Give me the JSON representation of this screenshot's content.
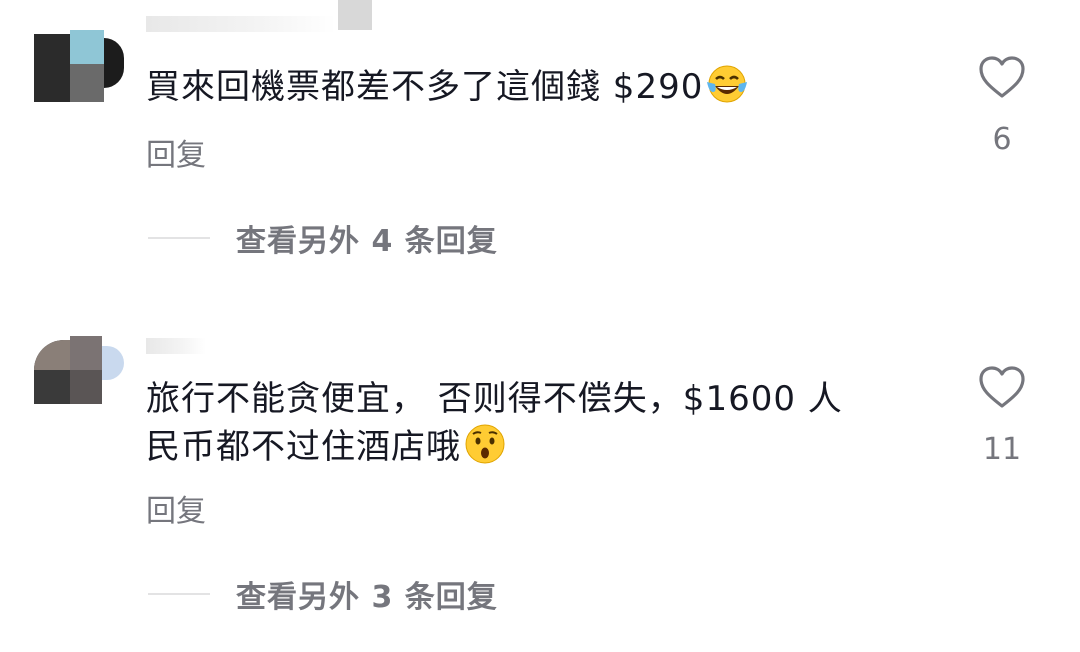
{
  "comments": [
    {
      "text": "買來回機票都差不多了這個錢 $290",
      "emoji": "tears-of-joy-emoji",
      "reply_label": "回复",
      "likes": "6",
      "view_replies": "查看另外 4 条回复"
    },
    {
      "text_line1": "旅行不能贪便宜， 否则得不偿失，$1600 人",
      "text_line2": "民币都不过住酒店哦",
      "emoji": "astonished-face-emoji",
      "reply_label": "回复",
      "likes": "11",
      "view_replies": "查看另外 3 条回复"
    }
  ],
  "icons": {
    "heart": "heart-outline-icon"
  },
  "colors": {
    "text_primary": "#161823",
    "text_secondary": "#75767d",
    "divider": "#e3e3e4"
  }
}
